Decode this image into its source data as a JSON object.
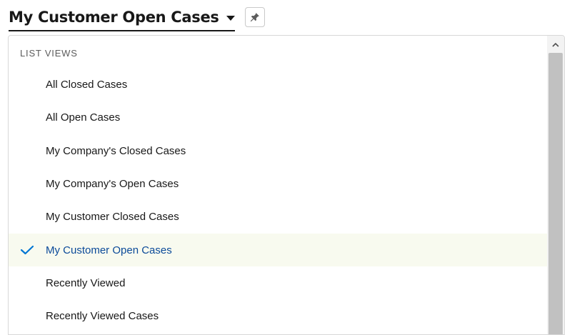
{
  "header": {
    "title": "My Customer Open Cases",
    "dropdown_icon": "chevron-down-icon",
    "pin_icon": "pin-icon"
  },
  "list_views": {
    "section_label": "LIST VIEWS",
    "items": [
      {
        "label": "All Closed Cases",
        "selected": false
      },
      {
        "label": "All Open Cases",
        "selected": false
      },
      {
        "label": "My Company's Closed Cases",
        "selected": false
      },
      {
        "label": "My Company's Open Cases",
        "selected": false
      },
      {
        "label": "My Customer Closed Cases",
        "selected": false
      },
      {
        "label": "My Customer Open Cases",
        "selected": true
      },
      {
        "label": "Recently Viewed",
        "selected": false
      },
      {
        "label": "Recently Viewed Cases",
        "selected": false
      }
    ]
  },
  "colors": {
    "accent": "#0b4a99",
    "selected_background": "#f8faef",
    "check": "#0176d3"
  }
}
